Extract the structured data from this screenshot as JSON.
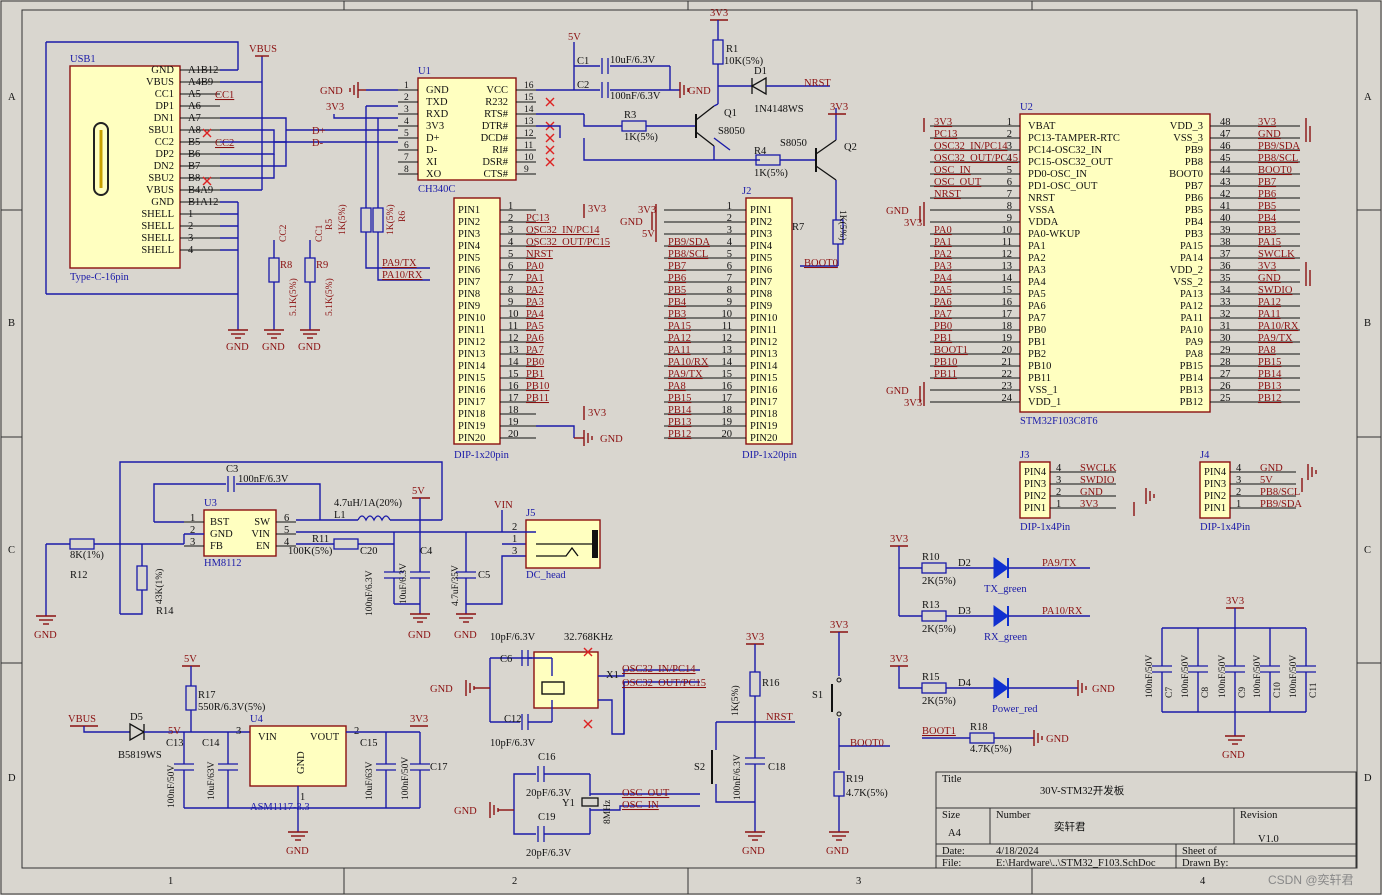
{
  "border": {
    "col_labels": [
      "1",
      "2",
      "3",
      "4"
    ],
    "row_labels": [
      "A",
      "B",
      "C",
      "D"
    ]
  },
  "title_block": {
    "title_label": "Title",
    "title": "30V-STM32开发板",
    "size_label": "Size",
    "size": "A4",
    "number_label": "Number",
    "number": "奕轩君",
    "revision_label": "Revision",
    "revision": "V1.0",
    "date_label": "Date:",
    "date": "4/18/2024",
    "sheet_label": "Sheet   of",
    "file_label": "File:",
    "file": "E:\\Hardware\\..\\STM32_F103.SchDoc",
    "drawn_label": "Drawn By:"
  },
  "watermark": "CSDN @奕轩君",
  "usb": {
    "ref": "USB1",
    "type": "Type-C-16pin",
    "pin_names": [
      "GND",
      "VBUS",
      "CC1",
      "DP1",
      "DN1",
      "SBU1",
      "CC2",
      "DP2",
      "DN2",
      "SBU2",
      "VBUS",
      "GND",
      "SHELL",
      "SHELL",
      "SHELL",
      "SHELL"
    ],
    "pin_nums": [
      "A1B12",
      "A4B9",
      "A5",
      "A6",
      "A7",
      "A8",
      "B5",
      "B6",
      "B7",
      "B8",
      "B4A9",
      "B1A12",
      "1",
      "2",
      "3",
      "4"
    ],
    "cc1": "CC1",
    "cc2": "CC2",
    "dplus": "D+",
    "dminus": "D-",
    "vbus": "VBUS",
    "gnd": "GND"
  },
  "ch340": {
    "ref": "U1",
    "part": "CH340C",
    "left_names": [
      "GND",
      "TXD",
      "RXD",
      "3V3",
      "D+",
      "D-",
      "XI",
      "XO"
    ],
    "left_nums": [
      "1",
      "2",
      "3",
      "4",
      "5",
      "6",
      "7",
      "8"
    ],
    "right_names": [
      "VCC",
      "R232",
      "RTS#",
      "DTR#",
      "DCD#",
      "RI#",
      "DSR#",
      "CTS#"
    ],
    "right_nums": [
      "16",
      "15",
      "14",
      "13",
      "12",
      "11",
      "10",
      "9"
    ],
    "gnd": "GND",
    "v3": "3V3",
    "v5": "5V"
  },
  "caps_top": {
    "c1": "C1",
    "c1v": "10uF/6.3V",
    "c2": "C2",
    "c2v": "100nF/6.3V",
    "gnd": "GND"
  },
  "reset_circuit": {
    "v3": "3V3",
    "r1": "R1",
    "r1v": "10K(5%)",
    "d1": "D1",
    "d1v": "1N4148WS",
    "nrst": "NRST",
    "q1": "Q1",
    "q1v": "S8050",
    "r3": "R3",
    "r3v": "1K(5%)",
    "r4": "R4",
    "r4v": "1K(5%)",
    "q2": "Q2",
    "q2v": "S8050",
    "r7v": "1K(5%)",
    "r7": "R7",
    "boot0": "BOOT0",
    "v3b": "3V3"
  },
  "r5r6": {
    "r5": "R5",
    "r5v": "1K(5%)",
    "r6": "R6",
    "r6v": "1K(5%)",
    "pa9": "PA9/TX",
    "pa10": "PA10/RX"
  },
  "r8r9": {
    "cc2": "CC2",
    "cc1": "CC1",
    "r8": "R8",
    "r8v": "5.1K(5%)",
    "r9": "R9",
    "r9v": "5.1K(5%)"
  },
  "gnd_label": "GND",
  "dip1": {
    "ref": "DIP-1x20pin",
    "pins": [
      "PIN1",
      "PIN2",
      "PIN3",
      "PIN4",
      "PIN5",
      "PIN6",
      "PIN7",
      "PIN8",
      "PIN9",
      "PIN10",
      "PIN11",
      "PIN12",
      "PIN13",
      "PIN14",
      "PIN15",
      "PIN16",
      "PIN17",
      "PIN18",
      "PIN19",
      "PIN20"
    ],
    "nums": [
      "1",
      "2",
      "3",
      "4",
      "5",
      "6",
      "7",
      "8",
      "9",
      "10",
      "11",
      "12",
      "13",
      "14",
      "15",
      "16",
      "17",
      "18",
      "19",
      "20"
    ],
    "nets": [
      "",
      "PC13",
      "OSC32_IN/PC14",
      "OSC32_OUT/PC15",
      "NRST",
      "PA0",
      "PA1",
      "PA2",
      "PA3",
      "PA4",
      "PA5",
      "PA6",
      "PA7",
      "PB0",
      "PB1",
      "PB10",
      "PB11",
      "",
      "",
      ""
    ],
    "v3a": "3V3",
    "v3b": "3V3",
    "gnd": "GND"
  },
  "dip2": {
    "ref": "J2",
    "part": "DIP-1x20pin",
    "pins": [
      "PIN1",
      "PIN2",
      "PIN3",
      "PIN4",
      "PIN5",
      "PIN6",
      "PIN7",
      "PIN8",
      "PIN9",
      "PIN10",
      "PIN11",
      "PIN12",
      "PIN13",
      "PIN14",
      "PIN15",
      "PIN16",
      "PIN17",
      "PIN18",
      "PIN19",
      "PIN20"
    ],
    "nums": [
      "1",
      "2",
      "3",
      "4",
      "5",
      "6",
      "7",
      "8",
      "9",
      "10",
      "11",
      "12",
      "13",
      "14",
      "15",
      "16",
      "17",
      "18",
      "19",
      "20"
    ],
    "nets": [
      "",
      "",
      "",
      "PB9/SDA",
      "PB8/SCL",
      "PB7",
      "PB6",
      "PB5",
      "PB4",
      "PB3",
      "PA15",
      "PA12",
      "PA11",
      "PA10/RX",
      "PA9/TX",
      "PA8",
      "PB15",
      "PB14",
      "PB13",
      "PB12"
    ],
    "v3": "3V3",
    "gnd": "GND",
    "v5": "5V"
  },
  "stm32": {
    "ref": "U2",
    "part": "STM32F103C8T6",
    "left_names": [
      "VBAT",
      "PC13-TAMPER-RTC",
      "PC14-OSC32_IN",
      "PC15-OSC32_OUT",
      "PD0-OSC_IN",
      "PD1-OSC_OUT",
      "NRST",
      "VSSA",
      "VDDA",
      "PA0-WKUP",
      "PA1",
      "PA2",
      "PA3",
      "PA4",
      "PA5",
      "PA6",
      "PA7",
      "PB0",
      "PB1",
      "PB2",
      "PB10",
      "PB11",
      "VSS_1",
      "VDD_1"
    ],
    "left_nums": [
      "1",
      "2",
      "3",
      "4",
      "5",
      "6",
      "7",
      "8",
      "9",
      "10",
      "11",
      "12",
      "13",
      "14",
      "15",
      "16",
      "17",
      "18",
      "19",
      "20",
      "21",
      "22",
      "23",
      "24"
    ],
    "left_nets": [
      "3V3",
      "PC13",
      "OSC32_IN/PC14",
      "OSC32_OUT/PC15",
      "OSC_IN",
      "OSC_OUT",
      "NRST",
      "",
      "",
      "PA0",
      "PA1",
      "PA2",
      "PA3",
      "PA4",
      "PA5",
      "PA6",
      "PA7",
      "PB0",
      "PB1",
      "BOOT1",
      "PB10",
      "PB11",
      "",
      ""
    ],
    "right_names": [
      "VDD_3",
      "VSS_3",
      "PB9",
      "PB8",
      "BOOT0",
      "PB7",
      "PB6",
      "PB5",
      "PB4",
      "PB3",
      "PA15",
      "PA14",
      "VDD_2",
      "VSS_2",
      "PA13",
      "PA12",
      "PA11",
      "PA10",
      "PA9",
      "PA8",
      "PB15",
      "PB14",
      "PB13",
      "PB12"
    ],
    "right_nums": [
      "48",
      "47",
      "46",
      "45",
      "44",
      "43",
      "42",
      "41",
      "40",
      "39",
      "38",
      "37",
      "36",
      "35",
      "34",
      "33",
      "32",
      "31",
      "30",
      "29",
      "28",
      "27",
      "26",
      "25"
    ],
    "right_nets": [
      "3V3",
      "GND",
      "PB9/SDA",
      "PB8/SCL",
      "BOOT0",
      "PB7",
      "PB6",
      "PB5",
      "PB4",
      "PB3",
      "PA15",
      "SWCLK",
      "3V3",
      "GND",
      "SWDIO",
      "PA12",
      "PA11",
      "PA10/RX",
      "PA9/TX",
      "PA8",
      "PB15",
      "PB14",
      "PB13",
      "PB12"
    ],
    "gnd": "GND",
    "v3": "3V3"
  },
  "j3": {
    "ref": "J3",
    "part": "DIP-1x4Pin",
    "pins": [
      "PIN4",
      "PIN3",
      "PIN2",
      "PIN1"
    ],
    "nums": [
      "4",
      "3",
      "2",
      "1"
    ],
    "nets": [
      "SWCLK",
      "SWDIO",
      "GND",
      "3V3"
    ]
  },
  "j4": {
    "ref": "J4",
    "part": "DIP-1x4Pin",
    "pins": [
      "PIN4",
      "PIN3",
      "PIN2",
      "PIN1"
    ],
    "nums": [
      "4",
      "3",
      "2",
      "1"
    ],
    "nets": [
      "GND",
      "5V",
      "PB8/SCL",
      "PB9/SDA"
    ]
  },
  "buck": {
    "ref": "U3",
    "part": "HM8112",
    "left": [
      "BST",
      "GND",
      "FB"
    ],
    "left_nums": [
      "1",
      "2",
      "3"
    ],
    "right": [
      "SW",
      "VIN",
      "EN"
    ],
    "right_nums": [
      "6",
      "5",
      "4"
    ],
    "c3": "C3",
    "c3v": "100nF/6.3V",
    "l1": "L1",
    "l1v": "4.7uH/1A(20%)",
    "v5": "5V",
    "vin": "VIN",
    "r11": "R11",
    "r11v": "100K(5%)",
    "r12": "R12",
    "r12v": "8K(1%)",
    "r14": "R14",
    "r14v": "43K(1%)",
    "c20": "C20",
    "c20v": "100nF/6.3V",
    "c4": "C4",
    "c4v": "10uF/6.3V",
    "c5": "C5",
    "c5v": "4.7uF/35V",
    "j5": "J5",
    "j5part": "DC_head",
    "j5pins": [
      "2",
      "1",
      "3"
    ]
  },
  "crystal32": {
    "c6": "C6",
    "c6v": "10pF/6.3V",
    "freq": "32.768KHz",
    "x1": "X1",
    "c12": "C12",
    "c12v": "10pF/6.3V",
    "net1": "OSC32_IN/PC14",
    "net2": "OSC32_OUT/PC15"
  },
  "crystal8": {
    "c16": "C16",
    "c16v": "20pF/6.3V",
    "y1": "Y1",
    "freq": "8MHz",
    "c19": "C19",
    "c19v": "20pF/6.3V",
    "net1": "OSC_OUT",
    "net2": "OSC_IN"
  },
  "nrst_circuit": {
    "v3": "3V3",
    "r16": "R16",
    "r16v": "1K(5%)",
    "nrst": "NRST",
    "s2": "S2",
    "c18": "C18",
    "c18v": "100nF/6.3V"
  },
  "boot_circuit": {
    "v3": "3V3",
    "s1": "S1",
    "boot0": "BOOT0",
    "r19": "R19",
    "r19v": "4.7K(5%)"
  },
  "leds": {
    "v3a": "3V3",
    "r10": "R10",
    "r10v": "2K(5%)",
    "d2": "D2",
    "d2name": "TX_green",
    "net2": "PA9/TX",
    "r13": "R13",
    "r13v": "2K(5%)",
    "d3": "D3",
    "d3name": "RX_green",
    "net3": "PA10/RX",
    "v3b": "3V3",
    "r15": "R15",
    "r15v": "2K(5%)",
    "d4": "D4",
    "d4name": "Power_red",
    "boot1": "BOOT1",
    "r18": "R18",
    "r18v": "4.7K(5%)"
  },
  "decoupling": {
    "v3": "3V3",
    "vals": [
      "100nF/50V",
      "100nF/50V",
      "100nF/50V",
      "100nF/50V",
      "100nF/50V"
    ],
    "refs": [
      "C7",
      "C8",
      "C9",
      "C10",
      "C11"
    ]
  },
  "ldo": {
    "v5": "5V",
    "r17": "R17",
    "r17v": "550R/6.3V(5%)",
    "vbus": "VBUS",
    "d5": "D5",
    "d5v": "B5819WS",
    "v5b": "5V",
    "c13": "C13",
    "c13v": "100nF/50V",
    "c14": "C14",
    "c14v": "10uF/63V",
    "u4": "U4",
    "part": "ASM1117-3.3",
    "vin": "VIN",
    "vout": "VOUT",
    "gndpin": "GND",
    "pin1": "1",
    "pin2": "2",
    "pin3": "3",
    "c15": "C15",
    "c15v": "10uF/63V",
    "c17": "C17",
    "c17v": "100nF/50V",
    "v3": "3V3"
  }
}
